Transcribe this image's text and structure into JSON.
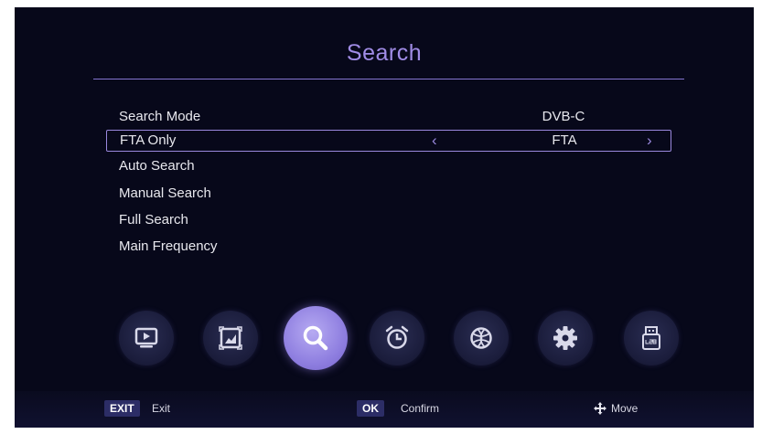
{
  "header": {
    "title": "Search"
  },
  "menu": {
    "items": [
      {
        "label": "Search Mode",
        "value": "DVB-C"
      },
      {
        "label": "FTA Only",
        "value": "FTA",
        "selected": true
      },
      {
        "label": "Auto Search",
        "value": ""
      },
      {
        "label": "Manual Search",
        "value": ""
      },
      {
        "label": "Full Search",
        "value": ""
      },
      {
        "label": "Main Frequency",
        "value": ""
      }
    ],
    "prev_arrow": "‹",
    "next_arrow": "›"
  },
  "toolbar": {
    "icons": [
      {
        "name": "tv-icon",
        "active": false
      },
      {
        "name": "picture-icon",
        "active": false
      },
      {
        "name": "search-icon",
        "active": true
      },
      {
        "name": "alarm-clock-icon",
        "active": false
      },
      {
        "name": "globe-icon",
        "active": false
      },
      {
        "name": "gear-icon",
        "active": false
      },
      {
        "name": "usb-icon",
        "active": false
      }
    ]
  },
  "footer": {
    "exit_key": "EXIT",
    "exit_label": "Exit",
    "ok_key": "OK",
    "ok_label": "Confirm",
    "move_label": "Move"
  },
  "colors": {
    "background": "#07081a",
    "accent": "#a08ce6",
    "active_icon": "#8f7fe0",
    "key_bg": "#2c2d66"
  }
}
